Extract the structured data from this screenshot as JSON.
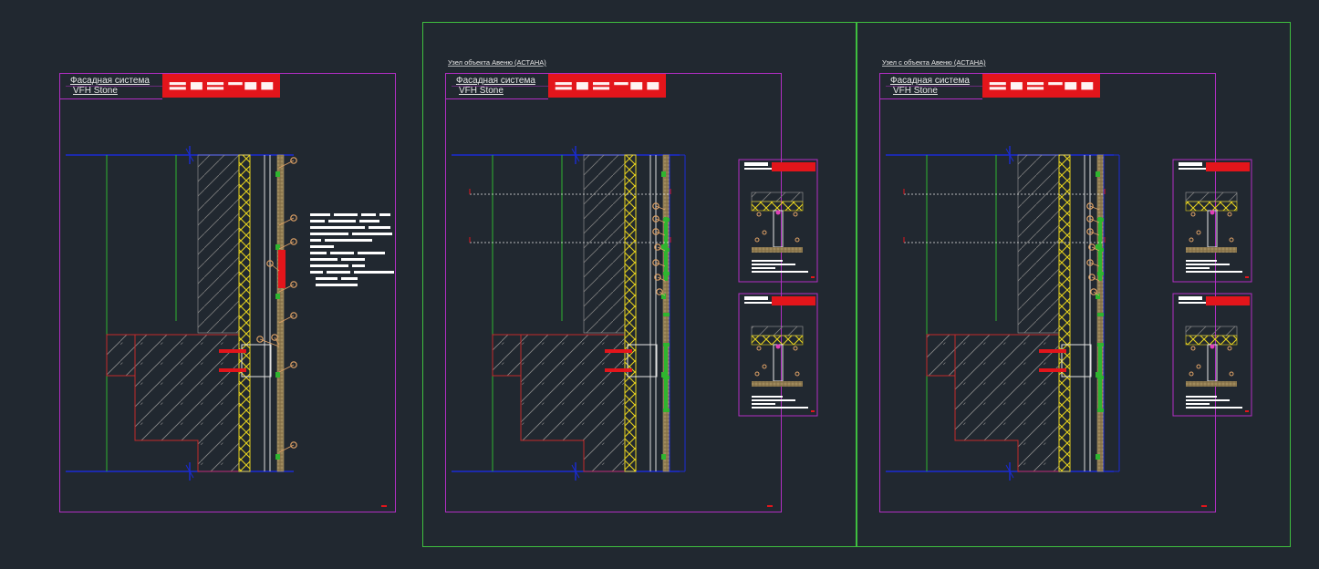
{
  "colors": {
    "background": "#212830",
    "sheet_frame": "#b22ec4",
    "viewport_frame": "#3fbf3f",
    "hilti_red": "#e3151b",
    "wall_hatch": "#c9c9c9",
    "concrete_outline": "#c42a2a",
    "insulation": "#e6d21e",
    "axis_blue": "#1a2bd6",
    "green_line": "#2fb52f",
    "cladding": "#b29a6a",
    "callout_bubble": "#e0a266",
    "text": "#e8e8e8"
  },
  "sheets": [
    {
      "id": "sheet-1",
      "title_line1": "Фасадная система",
      "title_line2": "VFH Stone",
      "logo_text": "HILTI"
    },
    {
      "id": "sheet-2",
      "caption": "Узел объекта Авеню (АСТАНА)",
      "title_line1": "Фасадная система",
      "title_line2": "VFH Stone",
      "logo_text": "HILTI"
    },
    {
      "id": "sheet-3",
      "caption": "Узел с объекта Авеню (АСТАНА)",
      "title_line1": "Фасадная система",
      "title_line2": "VFH Stone",
      "logo_text": "HILTI"
    }
  ]
}
